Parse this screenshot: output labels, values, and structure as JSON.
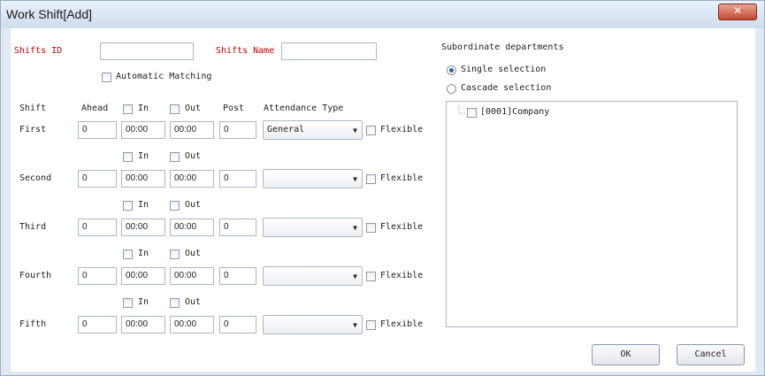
{
  "window": {
    "title": "Work Shift[Add]",
    "close_glyph": "✕"
  },
  "form": {
    "shifts_id_label": "Shifts ID",
    "shifts_id_value": "",
    "shifts_name_label": "Shifts Name",
    "shifts_name_value": "",
    "automatic_matching_label": "Automatic Matching",
    "automatic_matching_checked": false
  },
  "table": {
    "headers": {
      "shift": "Shift",
      "ahead": "Ahead",
      "in": "In",
      "out": "Out",
      "post": "Post",
      "attendance_type": "Attendance Type"
    },
    "flexible_label": "Flexible",
    "rows": [
      {
        "name": "First",
        "ahead": "0",
        "in": "00:00",
        "out": "00:00",
        "post": "0",
        "attendance_type": "General"
      },
      {
        "name": "Second",
        "ahead": "0",
        "in": "00:00",
        "out": "00:00",
        "post": "0",
        "attendance_type": ""
      },
      {
        "name": "Third",
        "ahead": "0",
        "in": "00:00",
        "out": "00:00",
        "post": "0",
        "attendance_type": ""
      },
      {
        "name": "Fourth",
        "ahead": "0",
        "in": "00:00",
        "out": "00:00",
        "post": "0",
        "attendance_type": ""
      },
      {
        "name": "Fifth",
        "ahead": "0",
        "in": "00:00",
        "out": "00:00",
        "post": "0",
        "attendance_type": ""
      }
    ]
  },
  "departments": {
    "group_label": "Subordinate departments",
    "single_selection_label": "Single selection",
    "cascade_selection_label": "Cascade selection",
    "selected_mode": "single",
    "tree_items": [
      {
        "label": "[0001]Company",
        "checked": false
      }
    ]
  },
  "buttons": {
    "ok": "OK",
    "cancel": "Cancel"
  },
  "colors": {
    "required_label": "#c40000",
    "title_bar": "#d6e2f0",
    "close_button": "#c64a33"
  },
  "icons": {
    "close": "close-icon",
    "dropdown": "chevron-down-icon",
    "tree_connector": "tree-line-icon"
  }
}
